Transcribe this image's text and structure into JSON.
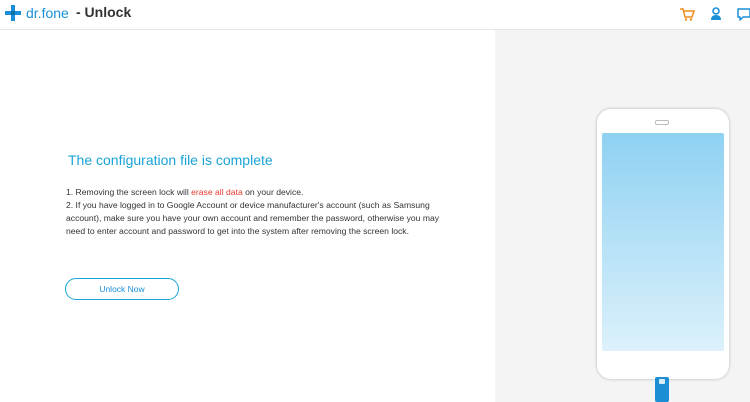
{
  "titlebar": {
    "brand": "dr.fone",
    "module": "- Unlock",
    "icons": [
      "plus-logo-icon",
      "cart-icon",
      "user-icon",
      "feedback-icon"
    ]
  },
  "content": {
    "heading": "The configuration file is complete",
    "line1_prefix": "1. Removing the screen lock will ",
    "line1_warning": "erase all data",
    "line1_suffix": " on your device.",
    "line2": "2. If you have logged in to Google Account or device manufacturer's account (such as Samsung account), make sure you have your own account and remember the password, otherwise you may need to enter account and password to get into the system after removing the screen lock.",
    "unlock_button": "Unlock Now"
  },
  "colors": {
    "brand_blue": "#1a8fd8",
    "heading_blue": "#1aa3d8",
    "warning_red": "#e8392f",
    "cart_orange": "#f08a1c",
    "cable_blue": "#1c8fd4"
  }
}
